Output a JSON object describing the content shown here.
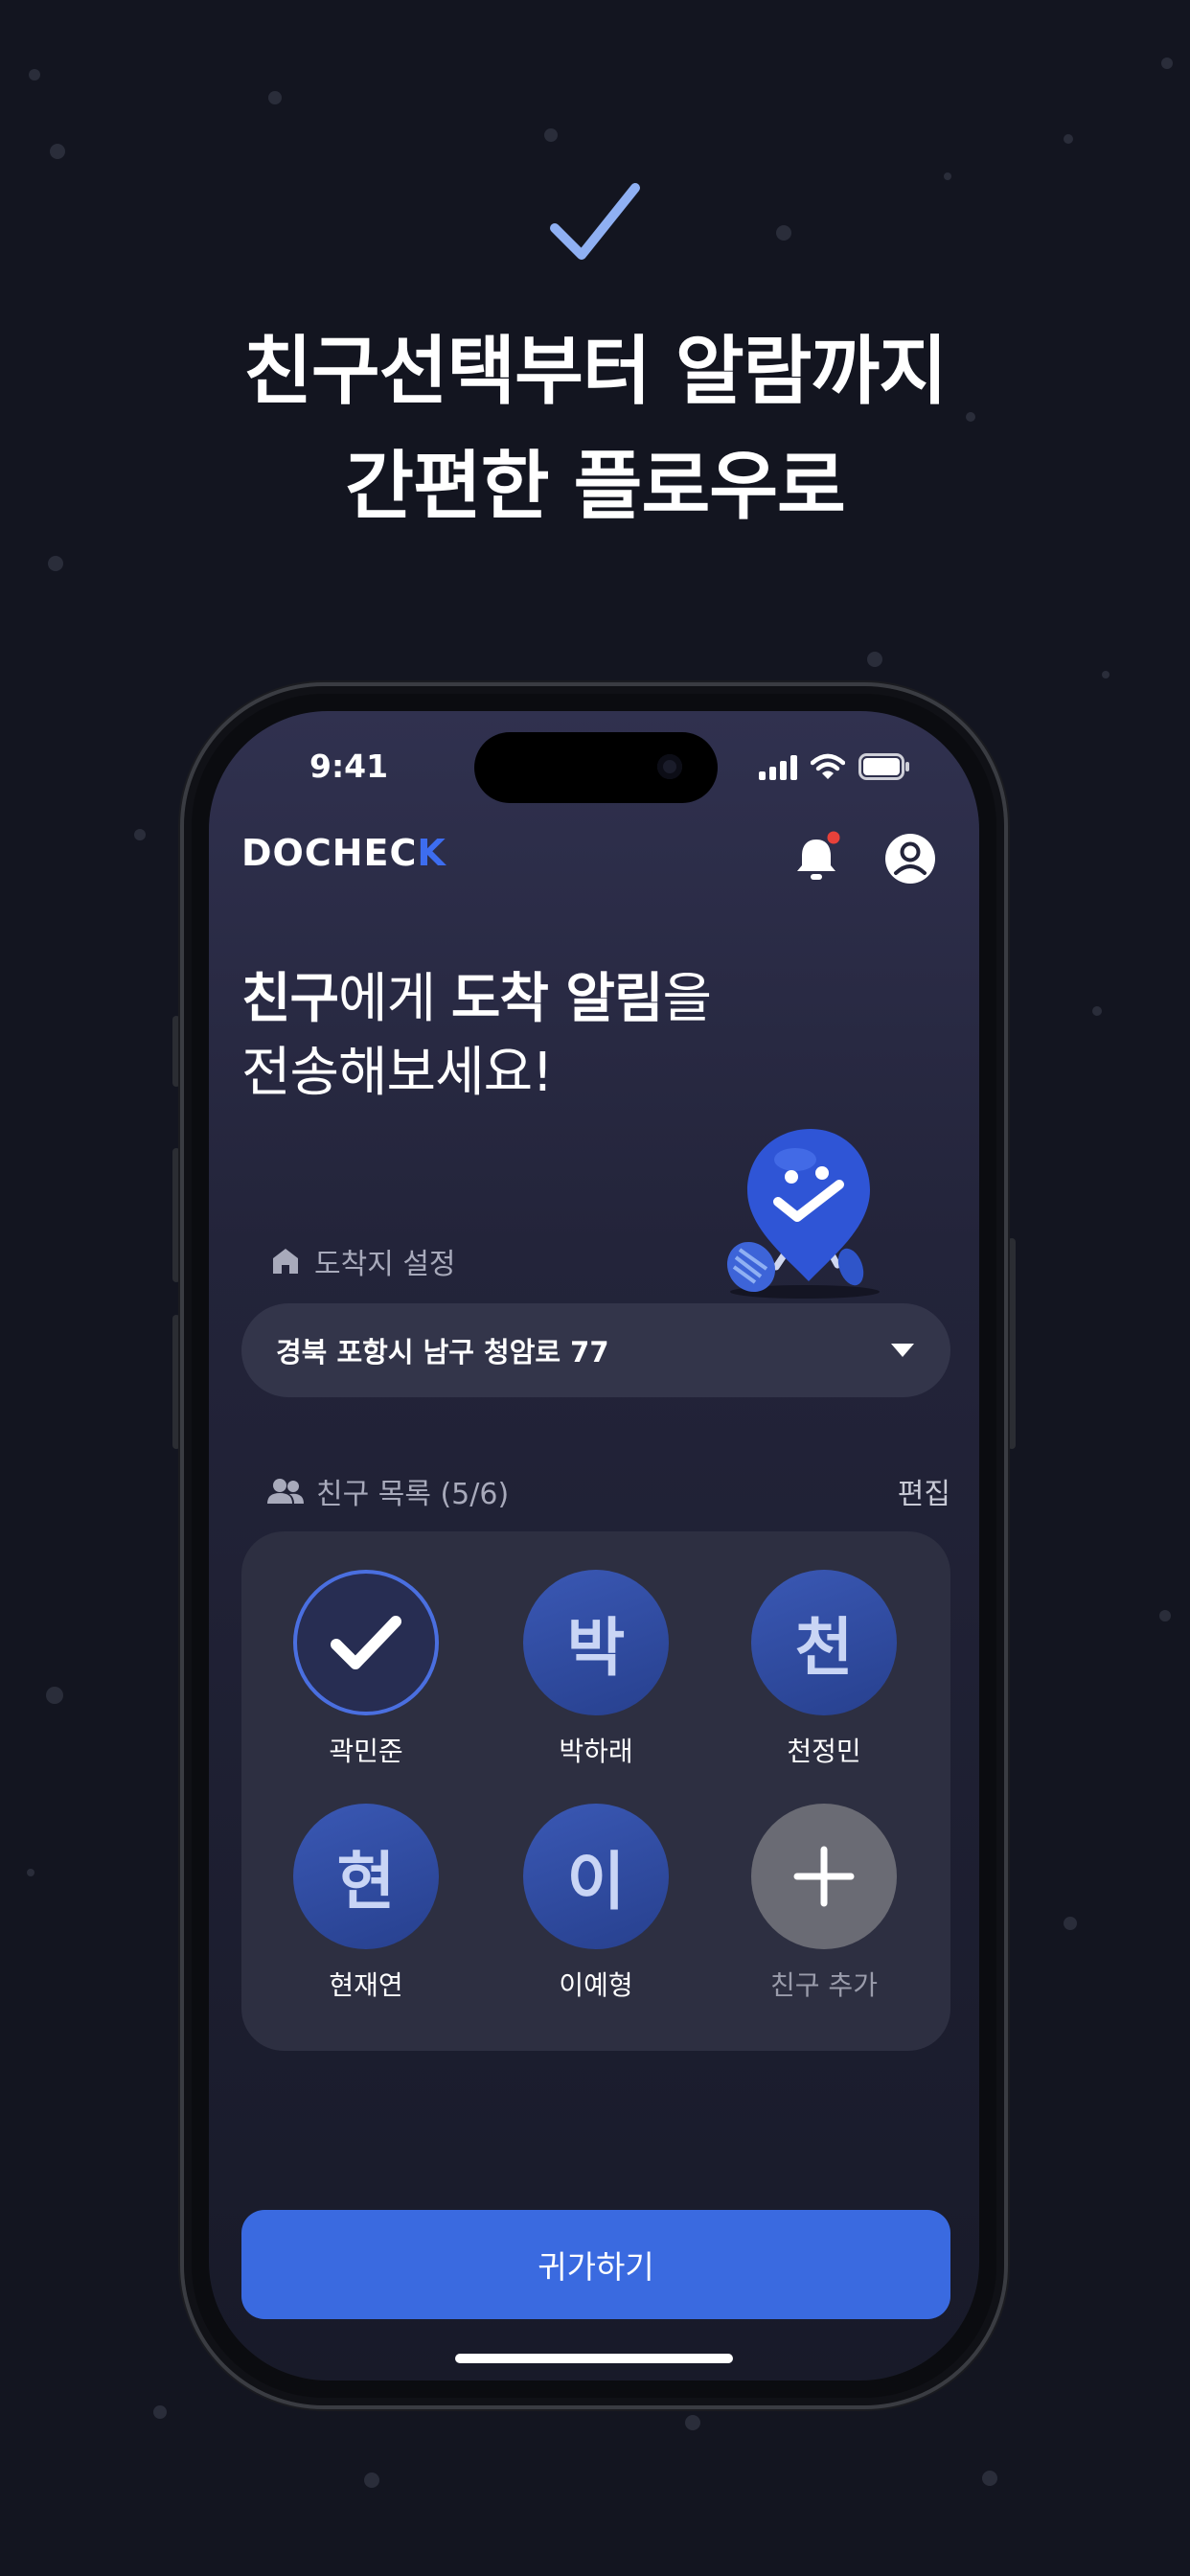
{
  "headline": {
    "line1": "친구선택부터 알람까지",
    "line2": "간편한 플로우로"
  },
  "status_bar": {
    "time": "9:41"
  },
  "app": {
    "logo_main": "DOCHEC",
    "logo_accent": "K",
    "accent_color": "#3A6AE0",
    "notification_dot_color": "#E8413A"
  },
  "hero": {
    "friend_word": "친구",
    "particle_1": "에게 ",
    "arrival_word": "도착 알림",
    "particle_2": "을",
    "line2": "전송해보세요!"
  },
  "destination": {
    "label": "도착지 설정",
    "value": "경북 포항시 남구 청암로 77"
  },
  "friends": {
    "title": "친구 목록 (5/6)",
    "edit_label": "편집",
    "list": [
      {
        "initial": "",
        "name": "곽민준",
        "selected": true
      },
      {
        "initial": "박",
        "name": "박하래",
        "selected": false
      },
      {
        "initial": "천",
        "name": "천정민",
        "selected": false
      },
      {
        "initial": "현",
        "name": "현재연",
        "selected": false
      },
      {
        "initial": "이",
        "name": "이예형",
        "selected": false
      }
    ],
    "add_label": "친구 추가"
  },
  "primary_button": {
    "label": "귀가하기"
  }
}
